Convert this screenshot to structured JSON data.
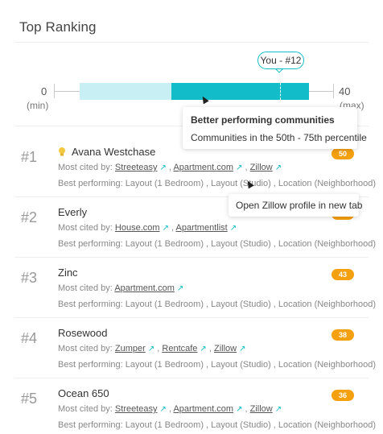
{
  "header": {
    "title": "Top Ranking"
  },
  "range": {
    "min_value": "0",
    "min_label": "(min)",
    "max_value": "40",
    "max_label": "(max)",
    "you_label": "You - #12",
    "accent_color": "#12bcc9",
    "light_color": "#c7eff4"
  },
  "tooltip": {
    "title": "Better performing communities",
    "text": "Communities in the 50th - 75th percentile"
  },
  "profile_tooltip": {
    "text": "Open Zillow profile in new tab"
  },
  "rankings": [
    {
      "rank": "#1",
      "name": "Avana Westchase",
      "badge": "50",
      "cited_label": "Most cited by:",
      "sources": [
        "Streeteasy",
        "Apartment.com",
        "Zillow"
      ],
      "best_label": "Best performing:",
      "best": "Layout (1 Bedroom) , Layout (Studio) , Location (Neighborhood)"
    },
    {
      "rank": "#2",
      "name": "Everly",
      "badge": "46",
      "cited_label": "Most cited by:",
      "sources": [
        "House.com",
        "Apartmentlist"
      ],
      "best_label": "Best performing:",
      "best": "Layout (1 Bedroom) , Layout (Studio) , Location (Neighborhood)"
    },
    {
      "rank": "#3",
      "name": "Zinc",
      "badge": "43",
      "cited_label": "Most cited by:",
      "sources": [
        "Apartment.com"
      ],
      "best_label": "Best performing:",
      "best": "Layout (1 Bedroom) , Layout (Studio) , Location (Neighborhood)"
    },
    {
      "rank": "#4",
      "name": "Rosewood",
      "badge": "38",
      "cited_label": "Most cited by:",
      "sources": [
        "Zumper",
        "Rentcafe",
        "Zillow"
      ],
      "best_label": "Best performing:",
      "best": "Layout (1 Bedroom) , Layout (Studio) , Location (Neighborhood)"
    },
    {
      "rank": "#5",
      "name": "Ocean 650",
      "badge": "36",
      "cited_label": "Most cited by:",
      "sources": [
        "Streeteasy",
        "Apartment.com",
        "Zillow"
      ],
      "best_label": "Best performing:",
      "best": "Layout (1 Bedroom) , Layout (Studio) , Location (Neighborhood)"
    }
  ]
}
